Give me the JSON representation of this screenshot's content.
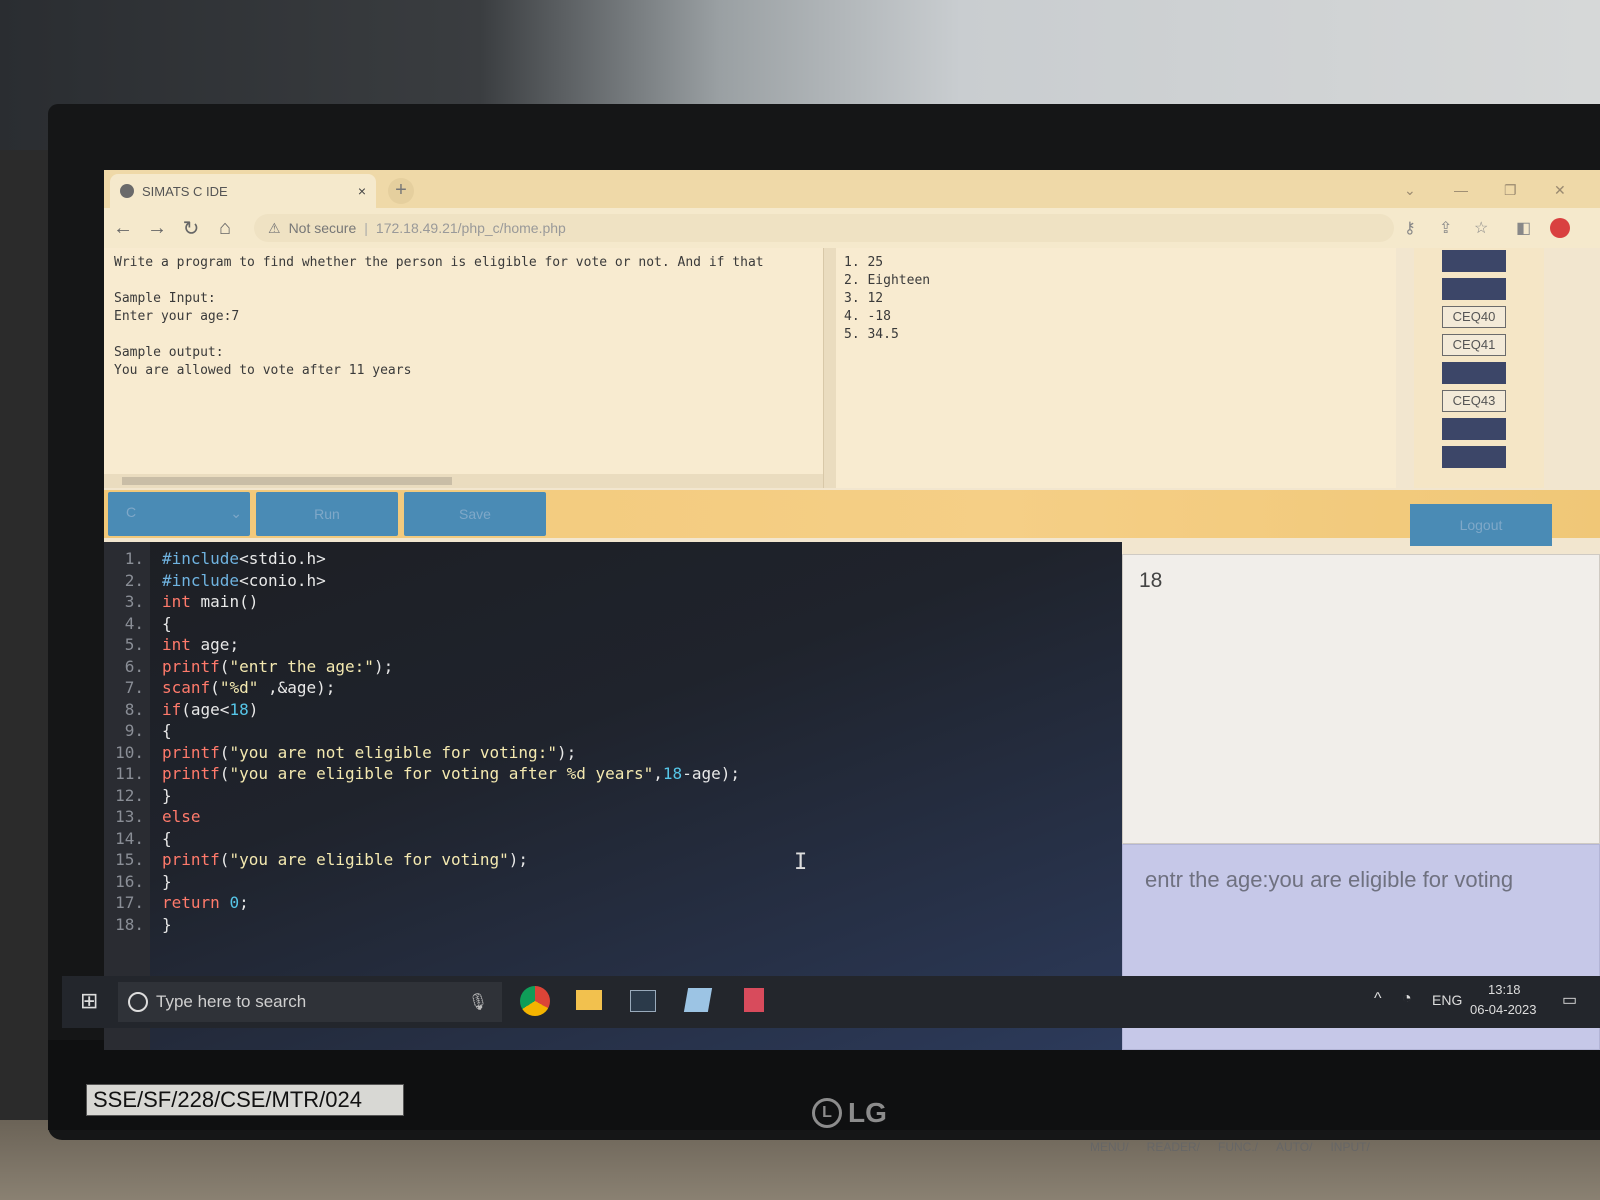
{
  "browser": {
    "tab_title": "SIMATS C IDE",
    "tab_close": "×",
    "new_tab": "+",
    "not_secure": "Not secure",
    "url": "172.18.49.21/php_c/home.php"
  },
  "question": {
    "text": "Write a program to find whether the person is eligible for vote or not. And if that\n\nSample Input:\nEnter your age:7\n\nSample output:\nYou are allowed to vote after 11 years"
  },
  "testcases": [
    "1. 25",
    "2. Eighteen",
    "3. 12",
    "4. -18",
    "5. 34.5"
  ],
  "question_buttons": [
    "",
    "",
    "CEQ40",
    "CEQ41",
    "",
    "CEQ43",
    "",
    ""
  ],
  "actions": {
    "language": "C",
    "run": "Run",
    "save": "Save",
    "logout": "Logout"
  },
  "editor": {
    "lines": [
      {
        "n": "1.",
        "html": "<span class=\"pp\">#include</span>&lt;stdio.h&gt;"
      },
      {
        "n": "2.",
        "html": "<span class=\"pp\">#include</span>&lt;conio.h&gt;"
      },
      {
        "n": "3.",
        "html": "<span class=\"kw\">int</span> main()"
      },
      {
        "n": "4.",
        "html": "{"
      },
      {
        "n": "5.",
        "html": "<span class=\"kw\">int</span> age;"
      },
      {
        "n": "6.",
        "html": "<span class=\"kw\">printf</span>(<span class=\"str\">\"entr the age:\"</span>);"
      },
      {
        "n": "7.",
        "html": "<span class=\"kw\">scanf</span>(<span class=\"str\">\"%d\"</span> ,&amp;age);"
      },
      {
        "n": "8.",
        "html": "<span class=\"kw\">if</span>(age&lt;<span class=\"num\">18</span>)"
      },
      {
        "n": "9.",
        "html": "{"
      },
      {
        "n": "10.",
        "html": "<span class=\"kw\">printf</span>(<span class=\"str\">\"you are not eligible for voting:\"</span>);"
      },
      {
        "n": "11.",
        "html": "<span class=\"kw\">printf</span>(<span class=\"str\">\"you are eligible for voting after %d years\"</span>,<span class=\"num\">18</span>-age);"
      },
      {
        "n": "12.",
        "html": "}"
      },
      {
        "n": "13.",
        "html": "<span class=\"kw\">else</span>"
      },
      {
        "n": "14.",
        "html": "{"
      },
      {
        "n": "15.",
        "html": "<span class=\"kw\">printf</span>(<span class=\"str\">\"you are eligible for voting\"</span>);"
      },
      {
        "n": "16.",
        "html": "}"
      },
      {
        "n": "17.",
        "html": "<span class=\"kw\">return</span> <span class=\"num\">0</span>;"
      },
      {
        "n": "18.",
        "html": "}"
      }
    ]
  },
  "io": {
    "input": "18",
    "output": "entr the age:you are eligible for voting"
  },
  "taskbar": {
    "search_placeholder": "Type here to search",
    "language": "ENG",
    "time": "13:18",
    "date": "06-04-2023"
  },
  "hardware": {
    "asset_tag": "SSE/SF/228/CSE/MTR/024",
    "brand": "LG",
    "buttons": [
      "MENU/",
      "READER/",
      "FUNC./",
      "AUTO/",
      "INPUT/"
    ]
  },
  "colors": {
    "action_bar": "#f1c879",
    "button_blue": "#4a8bb5",
    "editor_bg": "#1d1f24",
    "output_bg": "#c6c8e8"
  }
}
